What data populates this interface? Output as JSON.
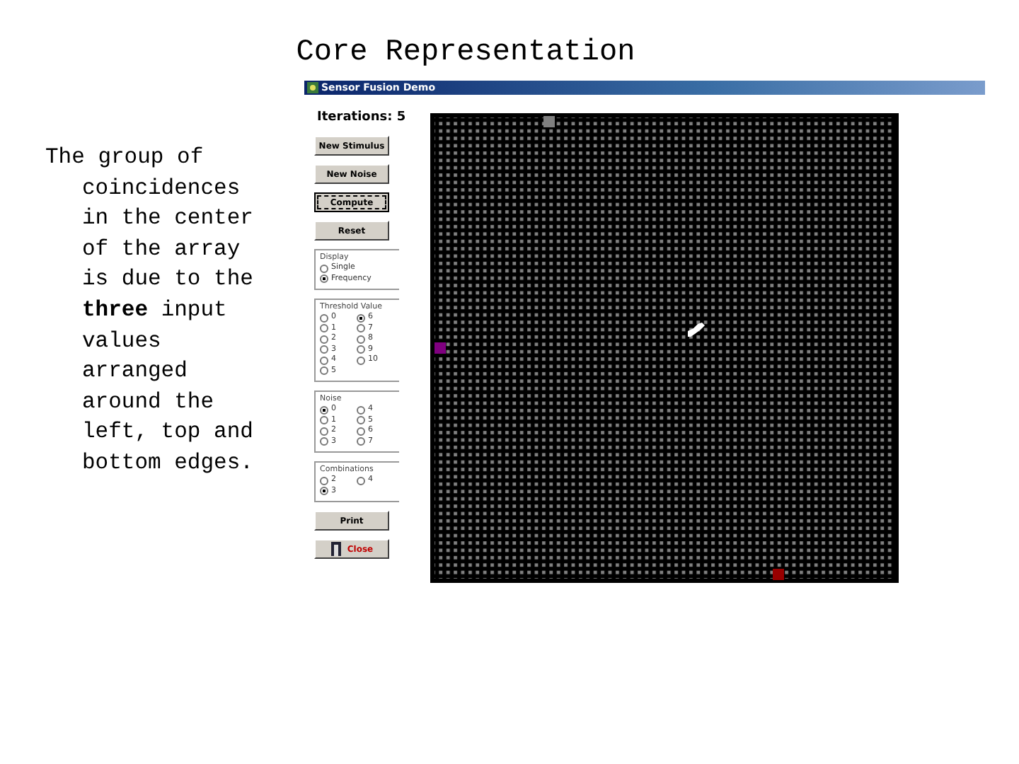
{
  "slide_title": "Core Representation",
  "caption": "The group of coincidences in the center of the array is due to the **three** input values arranged around the left, top and bottom edges.",
  "window": {
    "title": "Sensor Fusion Demo"
  },
  "iterations": "Iterations: 5",
  "top_buttons": [
    {
      "label": "New Stimulus",
      "kind": "plain",
      "focused": false
    },
    {
      "label": "New Noise",
      "kind": "plain",
      "focused": false
    },
    {
      "label": "Compute",
      "kind": "plain",
      "focused": true
    },
    {
      "label": "Reset",
      "kind": "plain",
      "focused": false
    }
  ],
  "groups": [
    {
      "title": "Display",
      "columns": [
        [
          {
            "label": "Single",
            "selected": false
          },
          {
            "label": "Frequency",
            "selected": true
          }
        ]
      ]
    },
    {
      "title": "Threshold Value",
      "columns": [
        [
          {
            "label": "0",
            "selected": false
          },
          {
            "label": "1",
            "selected": false
          },
          {
            "label": "2",
            "selected": false
          },
          {
            "label": "3",
            "selected": false
          },
          {
            "label": "4",
            "selected": false
          },
          {
            "label": "5",
            "selected": false
          }
        ],
        [
          {
            "label": "6",
            "selected": true
          },
          {
            "label": "7",
            "selected": false
          },
          {
            "label": "8",
            "selected": false
          },
          {
            "label": "9",
            "selected": false
          },
          {
            "label": "10",
            "selected": false
          }
        ]
      ]
    },
    {
      "title": "Noise",
      "columns": [
        [
          {
            "label": "0",
            "selected": true
          },
          {
            "label": "1",
            "selected": false
          },
          {
            "label": "2",
            "selected": false
          },
          {
            "label": "3",
            "selected": false
          }
        ],
        [
          {
            "label": "4",
            "selected": false
          },
          {
            "label": "5",
            "selected": false
          },
          {
            "label": "6",
            "selected": false
          },
          {
            "label": "7",
            "selected": false
          }
        ]
      ]
    },
    {
      "title": "Combinations",
      "columns": [
        [
          {
            "label": "2",
            "selected": false
          },
          {
            "label": "3",
            "selected": true
          }
        ],
        [
          {
            "label": "4",
            "selected": false
          }
        ]
      ]
    }
  ],
  "bottom_buttons": [
    {
      "label": "Print",
      "kind": "plain",
      "focused": false
    },
    {
      "label": "Close",
      "kind": "close",
      "focused": false
    }
  ],
  "markers": [
    {
      "color": "#808080"
    },
    {
      "color": "#800080"
    },
    {
      "color": "#990000"
    }
  ]
}
